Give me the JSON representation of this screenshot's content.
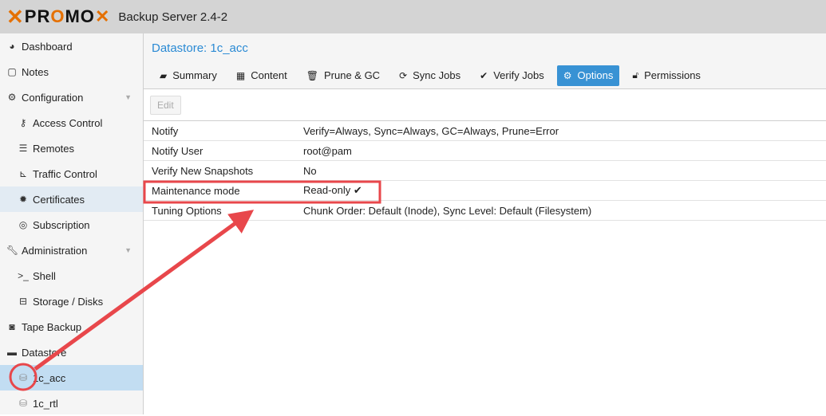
{
  "header": {
    "logo_text_1": "PR",
    "logo_text_2": "O",
    "logo_text_3": "MO",
    "product": "Backup Server 2.4-2"
  },
  "sidebar": {
    "items": [
      {
        "label": "Dashboard",
        "icon": "dashboard-icon"
      },
      {
        "label": "Notes",
        "icon": "notes-icon"
      },
      {
        "label": "Configuration",
        "icon": "gears-icon"
      },
      {
        "label": "Access Control",
        "icon": "key-icon"
      },
      {
        "label": "Remotes",
        "icon": "server-icon"
      },
      {
        "label": "Traffic Control",
        "icon": "signal-icon"
      },
      {
        "label": "Certificates",
        "icon": "certificate-icon"
      },
      {
        "label": "Subscription",
        "icon": "support-icon"
      },
      {
        "label": "Administration",
        "icon": "wrench-icon"
      },
      {
        "label": "Shell",
        "icon": "terminal-icon"
      },
      {
        "label": "Storage / Disks",
        "icon": "hdd-icon"
      },
      {
        "label": "Tape Backup",
        "icon": "tape-icon"
      },
      {
        "label": "Datastore",
        "icon": "archive-icon"
      },
      {
        "label": "1c_acc",
        "icon": "database-maintenance-icon"
      },
      {
        "label": "1c_rtl",
        "icon": "database-maintenance-icon"
      }
    ]
  },
  "main": {
    "title": "Datastore: 1c_acc",
    "tabs": [
      {
        "label": "Summary"
      },
      {
        "label": "Content"
      },
      {
        "label": "Prune & GC"
      },
      {
        "label": "Sync Jobs"
      },
      {
        "label": "Verify Jobs"
      },
      {
        "label": "Options"
      },
      {
        "label": "Permissions"
      }
    ],
    "edit_label": "Edit",
    "rows": [
      {
        "key": "Notify",
        "value": "Verify=Always, Sync=Always, GC=Always, Prune=Error"
      },
      {
        "key": "Notify User",
        "value": "root@pam"
      },
      {
        "key": "Verify New Snapshots",
        "value": "No"
      },
      {
        "key": "Maintenance mode",
        "value": "Read-only ✔"
      },
      {
        "key": "Tuning Options",
        "value": "Chunk Order: Default (Inode), Sync Level: Default (Filesystem)"
      }
    ]
  },
  "colors": {
    "accent": "#3892d4",
    "annotation": "#e8474b",
    "brand": "#e57000"
  }
}
